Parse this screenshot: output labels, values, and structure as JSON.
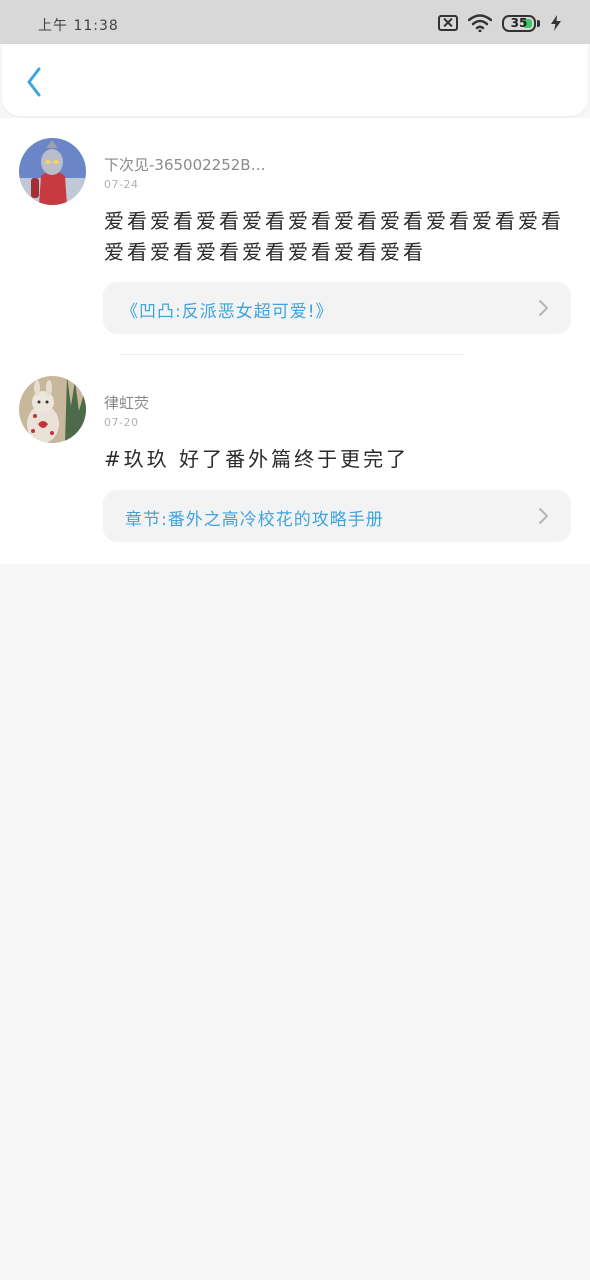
{
  "status_bar": {
    "time": "上午 11:38",
    "battery_level": "35",
    "icons": [
      "sim-off-icon",
      "wifi-icon",
      "battery-icon",
      "charging-bolt-icon"
    ]
  },
  "nav": {
    "back_icon": "chevron-left-icon"
  },
  "colors": {
    "accent": "#3fa4de",
    "battery_green": "#3cc76a"
  },
  "comments": [
    {
      "username": "下次见-365002252B…",
      "date": "07-24",
      "content": "爱看爱看爱看爱看爱看爱看爱看爱看爱看爱看爱看爱看爱看爱看爱看爱看爱看",
      "ref": "《凹凸:反派恶女超可爱!》"
    },
    {
      "username": "律虹荧",
      "date": "07-20",
      "content": "#玖玖 好了番外篇终于更完了",
      "ref": "章节:番外之高冷校花的攻略手册"
    }
  ]
}
